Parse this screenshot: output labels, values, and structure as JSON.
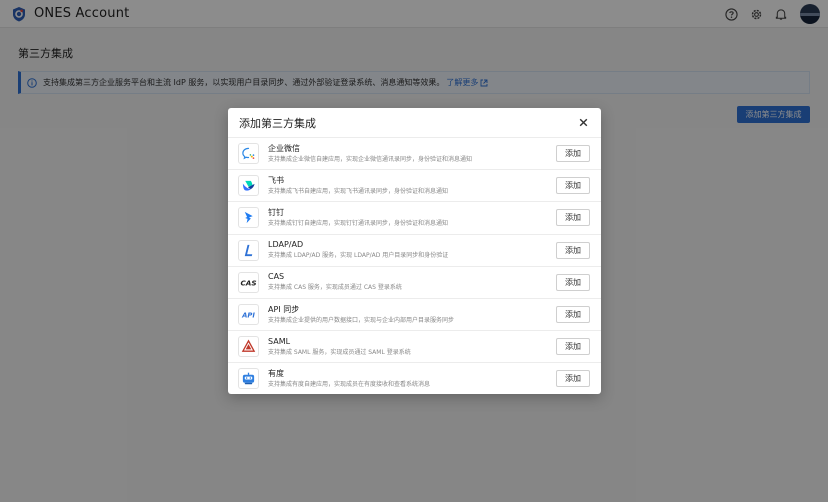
{
  "app": {
    "title": "ONES Account"
  },
  "header": {
    "icons": [
      "help-icon",
      "gear-icon",
      "bell-icon",
      "avatar"
    ]
  },
  "page": {
    "title": "第三方集成",
    "notice": {
      "text": "支持集成第三方企业服务平台和主流 IdP 服务，以实现用户目录同步、通过外部验证登录系统、消息通知等效果。",
      "link": "了解更多"
    },
    "add_button": "添加第三方集成"
  },
  "modal": {
    "title": "添加第三方集成",
    "items": [
      {
        "icon": "wecom-icon",
        "name": "企业微信",
        "desc": "支持集成企业微信自建应用，实现企业微信通讯录同步，身份验证和消息通知",
        "button": "添加"
      },
      {
        "icon": "feishu-icon",
        "name": "飞书",
        "desc": "支持集成飞书自建应用，实现飞书通讯录同步，身份验证和消息通知",
        "button": "添加"
      },
      {
        "icon": "dingtalk-icon",
        "name": "钉钉",
        "desc": "支持集成钉钉自建应用，实现钉钉通讯录同步，身份验证和消息通知",
        "button": "添加"
      },
      {
        "icon": "ldap-icon",
        "name": "LDAP/AD",
        "desc": "支持集成 LDAP/AD 服务，实现 LDAP/AD 用户目录同步和身份验证",
        "button": "添加"
      },
      {
        "icon": "cas-icon",
        "name": "CAS",
        "desc": "支持集成 CAS 服务，实现成员通过 CAS 登录系统",
        "button": "添加"
      },
      {
        "icon": "api-icon",
        "name": "API 同步",
        "desc": "支持集成企业提供的用户数据接口，实现与企业内部用户目录服务同步",
        "button": "添加"
      },
      {
        "icon": "saml-icon",
        "name": "SAML",
        "desc": "支持集成 SAML 服务，实现成员通过 SAML 登录系统",
        "button": "添加"
      },
      {
        "icon": "youdu-icon",
        "name": "有度",
        "desc": "支持集成有度自建应用，实现成员在有度接收和查看系统消息",
        "button": "添加"
      }
    ]
  },
  "colors": {
    "accent": "#2f72d6",
    "overlay": "rgba(0,0,0,0.45)"
  }
}
